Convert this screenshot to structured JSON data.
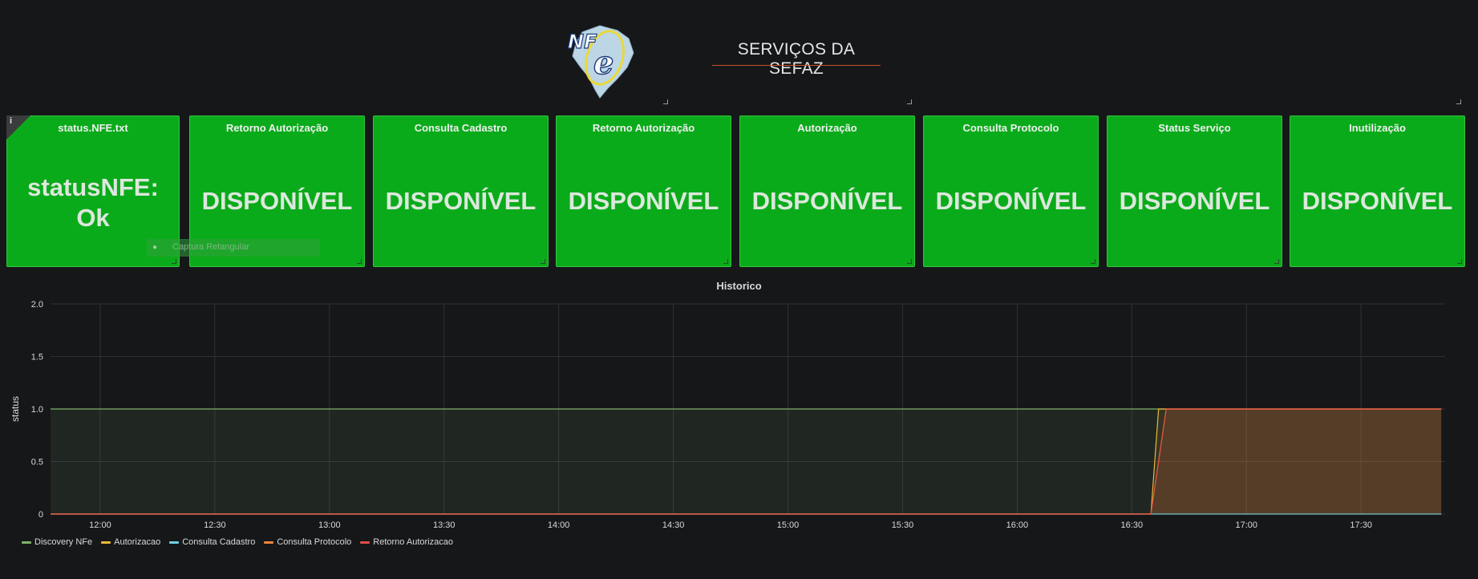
{
  "header": {
    "title": "SERVIÇOS DA SEFAZ",
    "logo_text": "NFe"
  },
  "panels": [
    {
      "title": "status.NFE.txt",
      "value": "statusNFE: Ok",
      "value_line1": "statusNFE:",
      "value_line2": "Ok",
      "has_info": true,
      "info_icon": "i"
    },
    {
      "title": "Retorno Autorização",
      "value": "DISPONÍVEL"
    },
    {
      "title": "Consulta Cadastro",
      "value": "DISPONÍVEL"
    },
    {
      "title": "Retorno Autorização",
      "value": "DISPONÍVEL"
    },
    {
      "title": "Autorização",
      "value": "DISPONÍVEL"
    },
    {
      "title": "Consulta Protocolo",
      "value": "DISPONÍVEL"
    },
    {
      "title": "Status Serviço",
      "value": "DISPONÍVEL"
    },
    {
      "title": "Inutilização",
      "value": "DISPONÍVEL"
    }
  ],
  "tooltip": {
    "text": "Captura Retangular"
  },
  "colors": {
    "panel_bg": "#0aab1a",
    "discovery": "#7eb26d",
    "autorizacao": "#eab839",
    "consulta_cadastro": "#6ed0e0",
    "consulta_protocolo": "#ef843c",
    "retorno_autorizacao": "#e24d42"
  },
  "chart_data": {
    "type": "line",
    "title": "Historico",
    "ylabel": "status",
    "xlabel": "",
    "ylim": [
      0,
      2
    ],
    "yticks": [
      "0",
      "0.5",
      "1.0",
      "1.5",
      "2.0"
    ],
    "ytick_values": [
      0,
      0.5,
      1.0,
      1.5,
      2.0
    ],
    "xlim": [
      "11:47",
      "17:52"
    ],
    "xticks": [
      "12:00",
      "12:30",
      "13:00",
      "13:30",
      "14:00",
      "14:30",
      "15:00",
      "15:30",
      "16:00",
      "16:30",
      "17:00",
      "17:30"
    ],
    "grid": true,
    "legend_position": "bottom-left",
    "series": [
      {
        "name": "Discovery NFe",
        "color": "#7eb26d",
        "points": [
          [
            "11:47",
            1
          ],
          [
            "17:51",
            1
          ]
        ]
      },
      {
        "name": "Autorizacao",
        "color": "#eab839",
        "points": [
          [
            "11:47",
            0
          ],
          [
            "16:35",
            0
          ],
          [
            "16:37",
            1
          ],
          [
            "17:51",
            1
          ]
        ]
      },
      {
        "name": "Consulta Cadastro",
        "color": "#6ed0e0",
        "points": [
          [
            "11:47",
            0
          ],
          [
            "17:51",
            0
          ]
        ]
      },
      {
        "name": "Consulta Protocolo",
        "color": "#ef843c",
        "points": [
          [
            "11:47",
            0
          ],
          [
            "16:35",
            0
          ],
          [
            "16:39",
            1
          ],
          [
            "17:51",
            1
          ]
        ]
      },
      {
        "name": "Retorno Autorizacao",
        "color": "#e24d42",
        "points": [
          [
            "11:47",
            0
          ],
          [
            "16:35",
            0
          ],
          [
            "16:39",
            1
          ],
          [
            "17:51",
            1
          ]
        ]
      }
    ]
  }
}
